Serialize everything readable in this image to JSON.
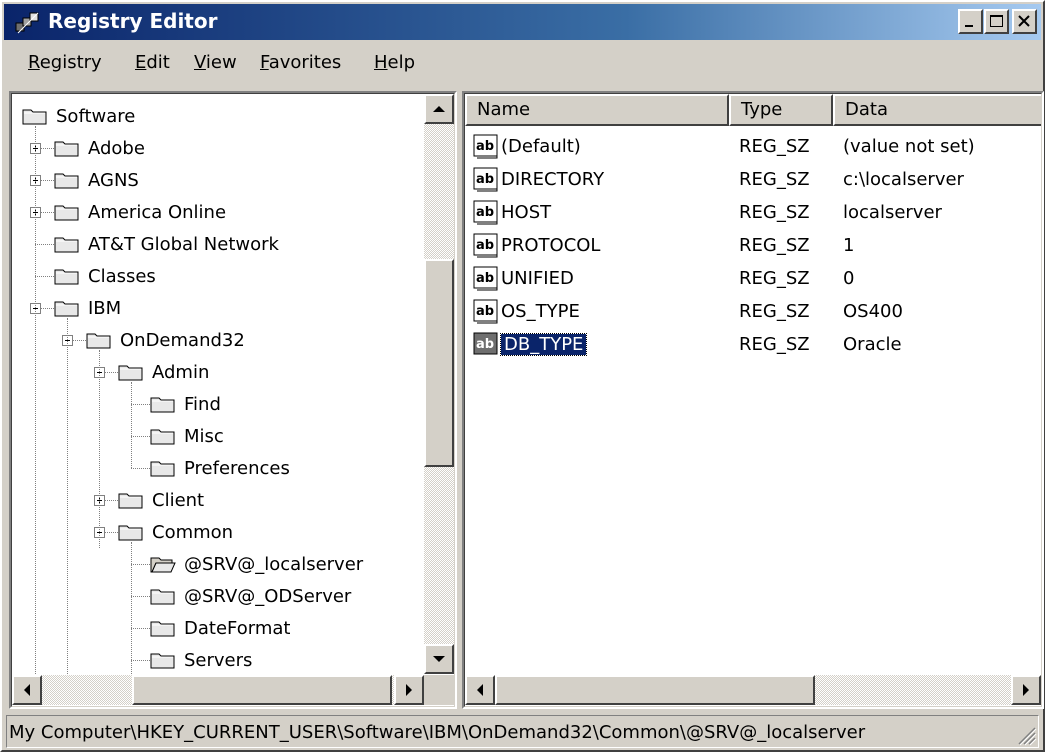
{
  "window": {
    "title": "Registry Editor"
  },
  "menu": [
    {
      "label": "Registry",
      "accel": "R"
    },
    {
      "label": "Edit",
      "accel": "E"
    },
    {
      "label": "View",
      "accel": "V"
    },
    {
      "label": "Favorites",
      "accel": "F"
    },
    {
      "label": "Help",
      "accel": "H"
    }
  ],
  "tree": [
    {
      "label": "Software",
      "level": 0,
      "expander": "none"
    },
    {
      "label": "Adobe",
      "level": 1,
      "expander": "plus"
    },
    {
      "label": "AGNS",
      "level": 1,
      "expander": "plus"
    },
    {
      "label": "America Online",
      "level": 1,
      "expander": "plus"
    },
    {
      "label": "AT&T Global Network",
      "level": 1,
      "expander": "none"
    },
    {
      "label": "Classes",
      "level": 1,
      "expander": "none"
    },
    {
      "label": "IBM",
      "level": 1,
      "expander": "minus"
    },
    {
      "label": "OnDemand32",
      "level": 2,
      "expander": "minus"
    },
    {
      "label": "Admin",
      "level": 3,
      "expander": "minus"
    },
    {
      "label": "Find",
      "level": 4,
      "expander": "none"
    },
    {
      "label": "Misc",
      "level": 4,
      "expander": "none"
    },
    {
      "label": "Preferences",
      "level": 4,
      "expander": "none"
    },
    {
      "label": "Client",
      "level": 3,
      "expander": "plus"
    },
    {
      "label": "Common",
      "level": 3,
      "expander": "minus"
    },
    {
      "label": "@SRV@_localserver",
      "level": 4,
      "expander": "none",
      "open": true
    },
    {
      "label": "@SRV@_ODServer",
      "level": 4,
      "expander": "none"
    },
    {
      "label": "DateFormat",
      "level": 4,
      "expander": "none"
    },
    {
      "label": "Servers",
      "level": 4,
      "expander": "none"
    }
  ],
  "list": {
    "columns": [
      "Name",
      "Type",
      "Data"
    ],
    "rows": [
      {
        "name": "(Default)",
        "type": "REG_SZ",
        "data": "(value not set)"
      },
      {
        "name": "DIRECTORY",
        "type": "REG_SZ",
        "data": "c:\\localserver"
      },
      {
        "name": "HOST",
        "type": "REG_SZ",
        "data": "localserver"
      },
      {
        "name": "PROTOCOL",
        "type": "REG_SZ",
        "data": "1"
      },
      {
        "name": "UNIFIED",
        "type": "REG_SZ",
        "data": "0"
      },
      {
        "name": "OS_TYPE",
        "type": "REG_SZ",
        "data": "OS400"
      },
      {
        "name": "DB_TYPE",
        "type": "REG_SZ",
        "data": "Oracle",
        "selected": true
      }
    ]
  },
  "status": {
    "path": "My Computer\\HKEY_CURRENT_USER\\Software\\IBM\\OnDemand32\\Common\\@SRV@_localserver"
  },
  "colors": {
    "title_start": "#0a246a",
    "title_end": "#a6caf0",
    "face": "#d4d0c8",
    "selection": "#0a246a"
  }
}
